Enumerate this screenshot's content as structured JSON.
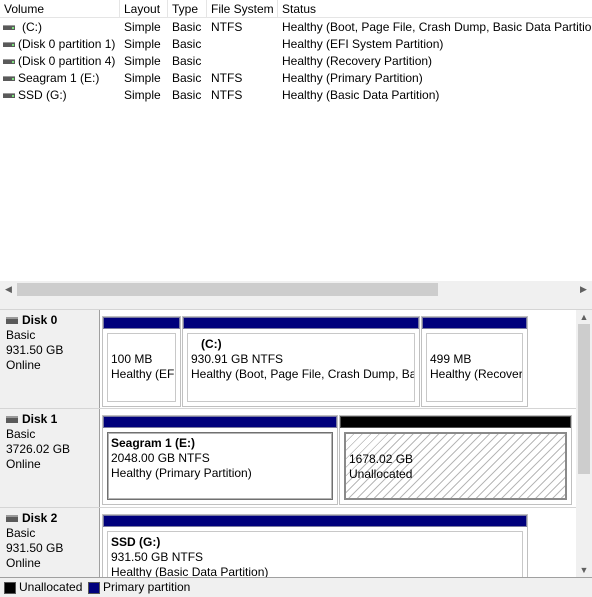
{
  "columns": {
    "volume": "Volume",
    "layout": "Layout",
    "type": "Type",
    "file_system": "File System",
    "status": "Status"
  },
  "volumes": [
    {
      "name": "(C:)",
      "layout": "Simple",
      "type": "Basic",
      "fs": "NTFS",
      "status": "Healthy (Boot, Page File, Crash Dump, Basic Data Partition)",
      "icon": "drive-icon"
    },
    {
      "name": "(Disk 0 partition 1)",
      "layout": "Simple",
      "type": "Basic",
      "fs": "",
      "status": "Healthy (EFI System Partition)",
      "icon": "drive-icon"
    },
    {
      "name": "(Disk 0 partition 4)",
      "layout": "Simple",
      "type": "Basic",
      "fs": "",
      "status": "Healthy (Recovery Partition)",
      "icon": "drive-icon"
    },
    {
      "name": "Seagram 1 (E:)",
      "layout": "Simple",
      "type": "Basic",
      "fs": "NTFS",
      "status": "Healthy (Primary Partition)",
      "icon": "drive-icon"
    },
    {
      "name": "SSD (G:)",
      "layout": "Simple",
      "type": "Basic",
      "fs": "NTFS",
      "status": "Healthy (Basic Data Partition)",
      "icon": "drive-icon"
    }
  ],
  "scroll_arrows": {
    "left": "◀",
    "right": "▶",
    "up": "▲",
    "down": "▼"
  },
  "disks": [
    {
      "name": "Disk 0",
      "type": "Basic",
      "size": "931.50 GB",
      "state": "Online",
      "partitions": [
        {
          "label": "",
          "size": "100 MB",
          "status": "Healthy (EFI",
          "bar": "primary"
        },
        {
          "label": "(C:)",
          "size": "930.91 GB NTFS",
          "status": "Healthy (Boot, Page File, Crash Dump, Bas",
          "bar": "primary"
        },
        {
          "label": "",
          "size": "499 MB",
          "status": "Healthy (Recovery",
          "bar": "primary"
        }
      ]
    },
    {
      "name": "Disk 1",
      "type": "Basic",
      "size": "3726.02 GB",
      "state": "Online",
      "partitions": [
        {
          "label": "Seagram 1  (E:)",
          "size": "2048.00 GB NTFS",
          "status": "Healthy (Primary Partition)",
          "bar": "primary"
        },
        {
          "label": "",
          "size": "1678.02 GB",
          "status": "Unallocated",
          "bar": "unallocated"
        }
      ]
    },
    {
      "name": "Disk 2",
      "type": "Basic",
      "size": "931.50 GB",
      "state": "Online",
      "partitions": [
        {
          "label": "SSD  (G:)",
          "size": "931.50 GB NTFS",
          "status": "Healthy (Basic Data Partition)",
          "bar": "primary"
        }
      ]
    }
  ],
  "legend": {
    "unallocated": {
      "label": "Unallocated",
      "color": "#000000"
    },
    "primary": {
      "label": "Primary partition",
      "color": "#00007c"
    }
  }
}
